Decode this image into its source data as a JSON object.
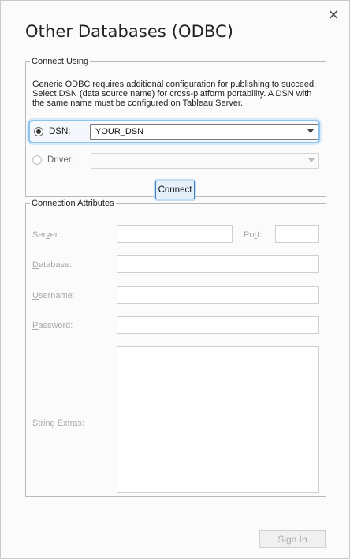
{
  "dialog": {
    "title": "Other Databases (ODBC)",
    "close_glyph": "✕"
  },
  "connect_using": {
    "legend": "Connect Using",
    "legend_accel": "C",
    "legend_rest": "onnect Using",
    "description": "Generic ODBC requires additional configuration for publishing to succeed. Select DSN (data source name) for cross-platform portability. A DSN with the same name must be configured on Tableau Server.",
    "dsn": {
      "label": "DSN:",
      "selected": true,
      "value": "YOUR_DSN"
    },
    "driver": {
      "label": "Driver:",
      "selected": false,
      "value": ""
    },
    "connect_label": "Connect"
  },
  "attributes": {
    "legend_pre": "Connection ",
    "legend_accel": "A",
    "legend_post": "ttributes",
    "server": {
      "pre": "Ser",
      "accel": "v",
      "post": "er:",
      "value": ""
    },
    "port": {
      "pre": "Po",
      "accel": "r",
      "post": "t:",
      "value": ""
    },
    "database": {
      "pre": "",
      "accel": "D",
      "post": "atabase:",
      "value": ""
    },
    "username": {
      "pre": "",
      "accel": "U",
      "post": "sername:",
      "value": ""
    },
    "password": {
      "pre": "",
      "accel": "P",
      "post": "assword:",
      "value": ""
    },
    "string_extras": {
      "label": "String Extras:",
      "value": ""
    }
  },
  "footer": {
    "signin_label": "Sign In"
  },
  "colors": {
    "focus": "#8fc3ea",
    "button_border": "#3d7fc1",
    "disabled_text": "#a9a9a9"
  }
}
